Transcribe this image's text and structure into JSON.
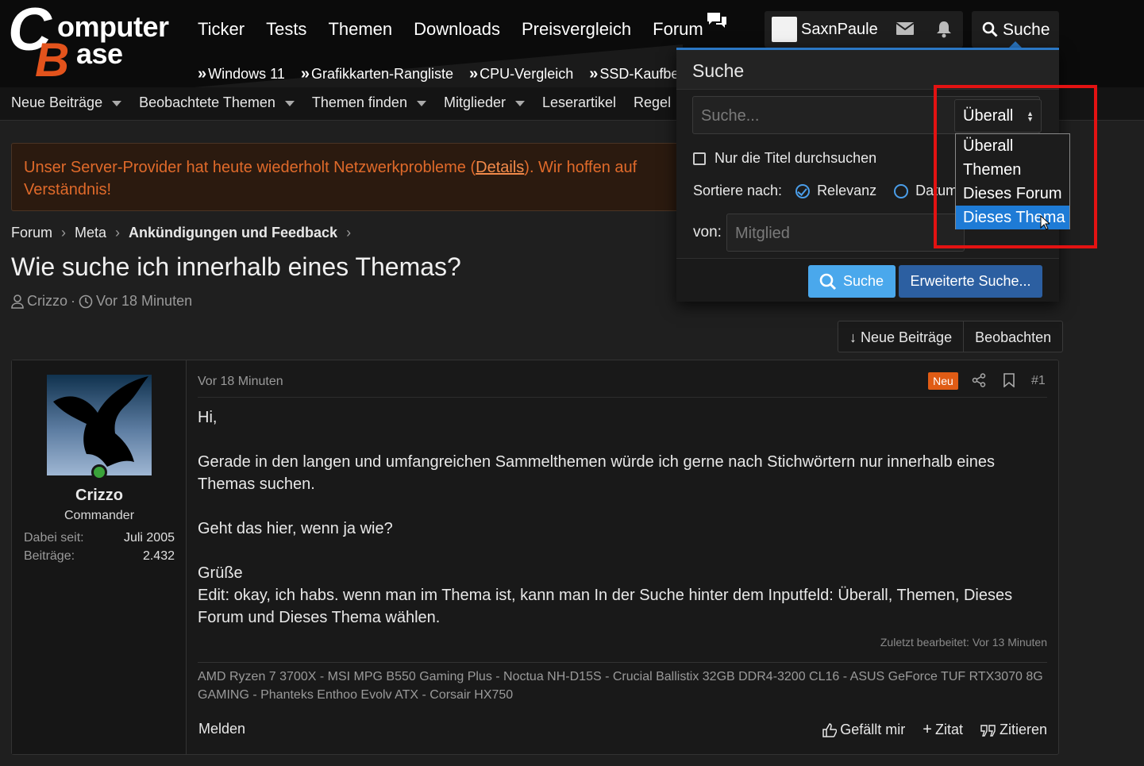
{
  "logo": {
    "c": "C",
    "b": "B",
    "t1": "omputer",
    "t2": "ase"
  },
  "mainnav": [
    "Ticker",
    "Tests",
    "Themen",
    "Downloads",
    "Preisvergleich",
    "Forum"
  ],
  "subnav": [
    "Windows 11",
    "Grafikkarten-Rangliste",
    "CPU-Vergleich",
    "SSD-Kaufbe"
  ],
  "subnav_prefix": "»",
  "user": {
    "name": "SaxnPaule"
  },
  "search_button": "Suche",
  "navbar": [
    {
      "label": "Neue Beiträge",
      "dropdown": true
    },
    {
      "label": "Beobachtete Themen",
      "dropdown": true
    },
    {
      "label": "Themen finden",
      "dropdown": true
    },
    {
      "label": "Mitglieder",
      "dropdown": true
    },
    {
      "label": "Leserartikel",
      "dropdown": false
    },
    {
      "label": "Regel",
      "dropdown": false
    }
  ],
  "notice": {
    "before": "Unser Server-Provider hat heute wiederholt Netzwerkprobleme (",
    "link": "Details",
    "after": "). Wir hoffen auf",
    "line2": "Verständnis!"
  },
  "breadcrumb": [
    "Forum",
    "Meta",
    "Ankündigungen und Feedback"
  ],
  "thread": {
    "title": "Wie suche ich innerhalb eines Themas?",
    "author": "Crizzo",
    "sep": "·",
    "time": "Vor 18 Minuten"
  },
  "buttons": {
    "new_posts": "↓ Neue Beiträge",
    "watch": "Beobachten"
  },
  "post": {
    "time": "Vor 18 Minuten",
    "badge": "Neu",
    "number": "#1",
    "author": "Crizzo",
    "rank": "Commander",
    "joined_label": "Dabei seit:",
    "joined": "Juli 2005",
    "posts_label": "Beiträge:",
    "posts": "2.432",
    "body": {
      "p1": "Hi,",
      "p2": "Gerade in den langen und umfangreichen Sammelthemen würde ich gerne nach Stichwörtern nur innerhalb eines Themas suchen.",
      "p3": "Geht das hier, wenn ja wie?",
      "p4": "Grüße",
      "p5": "Edit: okay, ich habs. wenn man im Thema ist, kann man In der Suche hinter dem Inputfeld: Überall, Themen, Dieses Forum und Dieses Thema wählen."
    },
    "edited": "Zuletzt bearbeitet: Vor 13 Minuten",
    "signature": "AMD Ryzen 7 3700X - MSI MPG B550 Gaming Plus - Noctua NH-D15S - Crucial Ballistix 32GB DDR4-3200 CL16 - ASUS GeForce TUF RTX3070 8G GAMING - Phanteks Enthoo Evolv ATX - Corsair HX750",
    "report": "Melden",
    "like": "Gefällt mir",
    "quote": "Zitat",
    "reply": "Zitieren"
  },
  "search": {
    "title": "Suche",
    "placeholder": "Suche...",
    "scope_selected": "Überall",
    "scope_options": [
      "Überall",
      "Themen",
      "Dieses Forum",
      "Dieses Thema"
    ],
    "scope_highlighted": "Dieses Thema",
    "titles_only": "Nur die Titel durchsuchen",
    "sort_label": "Sortiere nach:",
    "sort_relevance": "Relevanz",
    "sort_date": "Datum",
    "von_label": "von:",
    "member_placeholder": "Mitglied",
    "submit": "Suche",
    "advanced": "Erweiterte Suche..."
  }
}
